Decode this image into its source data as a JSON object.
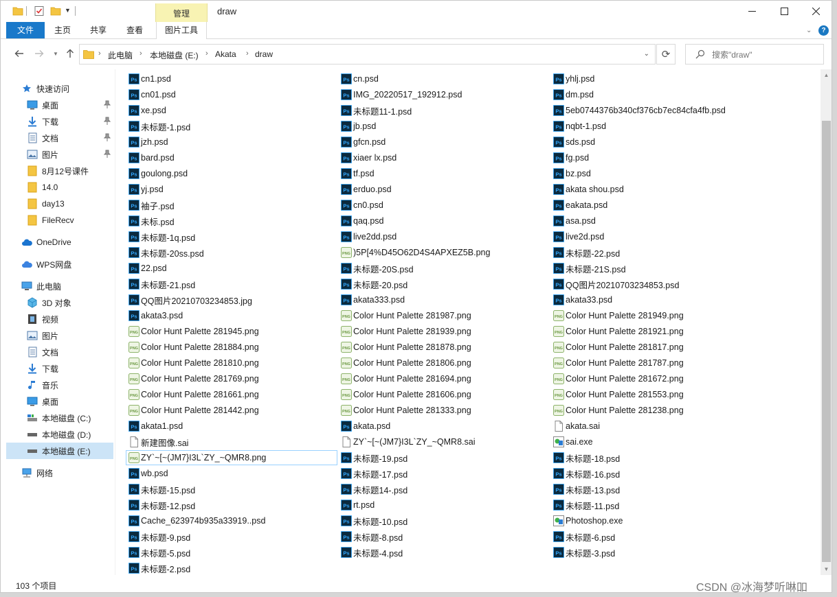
{
  "window": {
    "title": "draw"
  },
  "quick_access_toolbar": [
    "folder-icon",
    "properties-check-icon",
    "new-folder-icon"
  ],
  "ribbon": {
    "context_tab_group": "管理",
    "file_tab": "文件",
    "tabs": [
      "主页",
      "共享",
      "查看"
    ],
    "context_tab": "图片工具"
  },
  "address": {
    "crumbs": [
      "此电脑",
      "本地磁盘 (E:)",
      "Akata",
      "draw"
    ]
  },
  "search": {
    "placeholder": "搜索\"draw\""
  },
  "nav": {
    "quick_access": "快速访问",
    "pinned": [
      "桌面",
      "下载",
      "文档",
      "图片"
    ],
    "recent": [
      "8月12号课件",
      "14.0",
      "day13",
      "FileRecv"
    ],
    "onedrive": "OneDrive",
    "wps": "WPS网盘",
    "this_pc": "此电脑",
    "pc_items": [
      "3D 对象",
      "视频",
      "图片",
      "文档",
      "下载",
      "音乐",
      "桌面",
      "本地磁盘 (C:)",
      "本地磁盘 (D:)",
      "本地磁盘 (E:)"
    ],
    "network": "网络"
  },
  "files": {
    "columns": [
      [
        {
          "name": "cn1.psd",
          "type": "psd"
        },
        {
          "name": "cn01.psd",
          "type": "psd"
        },
        {
          "name": "xe.psd",
          "type": "psd"
        },
        {
          "name": "未标题-1.psd",
          "type": "psd"
        },
        {
          "name": "jzh.psd",
          "type": "psd"
        },
        {
          "name": "bard.psd",
          "type": "psd"
        },
        {
          "name": "goulong.psd",
          "type": "psd"
        },
        {
          "name": "yj.psd",
          "type": "psd"
        },
        {
          "name": "袖子.psd",
          "type": "psd"
        },
        {
          "name": "未标.psd",
          "type": "psd"
        },
        {
          "name": "未标题-1q.psd",
          "type": "psd"
        },
        {
          "name": "未标题-20ss.psd",
          "type": "psd"
        },
        {
          "name": "22.psd",
          "type": "psd"
        },
        {
          "name": "未标题-21.psd",
          "type": "psd"
        },
        {
          "name": "QQ图片20210703234853.jpg",
          "type": "psd"
        },
        {
          "name": "akata3.psd",
          "type": "psd"
        },
        {
          "name": "Color Hunt Palette 281945.png",
          "type": "png"
        },
        {
          "name": "Color Hunt Palette 281884.png",
          "type": "png"
        },
        {
          "name": "Color Hunt Palette 281810.png",
          "type": "png"
        },
        {
          "name": "Color Hunt Palette 281769.png",
          "type": "png"
        },
        {
          "name": "Color Hunt Palette 281661.png",
          "type": "png"
        },
        {
          "name": "Color Hunt Palette 281442.png",
          "type": "png"
        },
        {
          "name": "akata1.psd",
          "type": "psd"
        },
        {
          "name": "新建图像.sai",
          "type": "sai"
        },
        {
          "name": "ZY`~[~(JM7}I3L`ZY_~QMR8.png",
          "type": "png"
        },
        {
          "name": "wb.psd",
          "type": "psd"
        },
        {
          "name": "未标题-15.psd",
          "type": "psd"
        },
        {
          "name": "未标题-12.psd",
          "type": "psd"
        },
        {
          "name": "Cache_623974b935a33919..psd",
          "type": "psd"
        },
        {
          "name": "未标题-9.psd",
          "type": "psd"
        },
        {
          "name": "未标题-5.psd",
          "type": "psd"
        },
        {
          "name": "未标题-2.psd",
          "type": "psd"
        }
      ],
      [
        {
          "name": "cn.psd",
          "type": "psd"
        },
        {
          "name": "IMG_20220517_192912.psd",
          "type": "psd"
        },
        {
          "name": "未标题11-1.psd",
          "type": "psd"
        },
        {
          "name": "jb.psd",
          "type": "psd"
        },
        {
          "name": "gfcn.psd",
          "type": "psd"
        },
        {
          "name": "xiaer lx.psd",
          "type": "psd"
        },
        {
          "name": "tf.psd",
          "type": "psd"
        },
        {
          "name": "erduo.psd",
          "type": "psd"
        },
        {
          "name": "cn0.psd",
          "type": "psd"
        },
        {
          "name": "qaq.psd",
          "type": "psd"
        },
        {
          "name": "live2dd.psd",
          "type": "psd"
        },
        {
          "name": ")5P[4%D45O62D4S4APXEZ5B.png",
          "type": "png"
        },
        {
          "name": "未标题-20S.psd",
          "type": "psd"
        },
        {
          "name": "未标题-20.psd",
          "type": "psd"
        },
        {
          "name": "akata333.psd",
          "type": "psd"
        },
        {
          "name": "Color Hunt Palette 281987.png",
          "type": "png"
        },
        {
          "name": "Color Hunt Palette 281939.png",
          "type": "png"
        },
        {
          "name": "Color Hunt Palette 281878.png",
          "type": "png"
        },
        {
          "name": "Color Hunt Palette 281806.png",
          "type": "png"
        },
        {
          "name": "Color Hunt Palette 281694.png",
          "type": "png"
        },
        {
          "name": "Color Hunt Palette 281606.png",
          "type": "png"
        },
        {
          "name": "Color Hunt Palette 281333.png",
          "type": "png"
        },
        {
          "name": "akata.psd",
          "type": "psd"
        },
        {
          "name": "ZY`~[~(JM7}I3L`ZY_~QMR8.sai",
          "type": "sai"
        },
        {
          "name": "未标题-19.psd",
          "type": "psd"
        },
        {
          "name": "未标题-17.psd",
          "type": "psd"
        },
        {
          "name": "未标题14-.psd",
          "type": "psd"
        },
        {
          "name": "rt.psd",
          "type": "psd"
        },
        {
          "name": "未标题-10.psd",
          "type": "psd"
        },
        {
          "name": "未标题-8.psd",
          "type": "psd"
        },
        {
          "name": "未标题-4.psd",
          "type": "psd"
        }
      ],
      [
        {
          "name": "yhlj.psd",
          "type": "psd"
        },
        {
          "name": "dm.psd",
          "type": "psd"
        },
        {
          "name": "5eb0744376b340cf376cb7ec84cfa4fb.psd",
          "type": "psd"
        },
        {
          "name": "nqbt-1.psd",
          "type": "psd"
        },
        {
          "name": "sds.psd",
          "type": "psd"
        },
        {
          "name": "fg.psd",
          "type": "psd"
        },
        {
          "name": "bz.psd",
          "type": "psd"
        },
        {
          "name": "akata shou.psd",
          "type": "psd"
        },
        {
          "name": "eakata.psd",
          "type": "psd"
        },
        {
          "name": "asa.psd",
          "type": "psd"
        },
        {
          "name": "live2d.psd",
          "type": "psd"
        },
        {
          "name": "未标题-22.psd",
          "type": "psd"
        },
        {
          "name": "未标题-21S.psd",
          "type": "psd"
        },
        {
          "name": "QQ图片20210703234853.psd",
          "type": "psd"
        },
        {
          "name": "akata33.psd",
          "type": "psd"
        },
        {
          "name": "Color Hunt Palette 281949.png",
          "type": "png"
        },
        {
          "name": "Color Hunt Palette 281921.png",
          "type": "png"
        },
        {
          "name": "Color Hunt Palette 281817.png",
          "type": "png"
        },
        {
          "name": "Color Hunt Palette 281787.png",
          "type": "png"
        },
        {
          "name": "Color Hunt Palette 281672.png",
          "type": "png"
        },
        {
          "name": "Color Hunt Palette 281553.png",
          "type": "png"
        },
        {
          "name": "Color Hunt Palette 281238.png",
          "type": "png"
        },
        {
          "name": "akata.sai",
          "type": "sai"
        },
        {
          "name": "sai.exe",
          "type": "exe"
        },
        {
          "name": "未标题-18.psd",
          "type": "psd"
        },
        {
          "name": "未标题-16.psd",
          "type": "psd"
        },
        {
          "name": "未标题-13.psd",
          "type": "psd"
        },
        {
          "name": "未标题-11.psd",
          "type": "psd"
        },
        {
          "name": "Photoshop.exe",
          "type": "exe"
        },
        {
          "name": "未标题-6.psd",
          "type": "psd"
        },
        {
          "name": "未标题-3.psd",
          "type": "psd"
        }
      ]
    ],
    "focused": "ZY`~[~(JM7}I3L`ZY_~QMR8.png"
  },
  "status": {
    "count": "103 个项目"
  },
  "watermark": "CSDN @冰海梦听啉吅",
  "colors": {
    "accent": "#1979ca",
    "selected": "#cce4f7",
    "ps_icon": "#0b2a3e",
    "ps_text": "#31a8ff"
  }
}
